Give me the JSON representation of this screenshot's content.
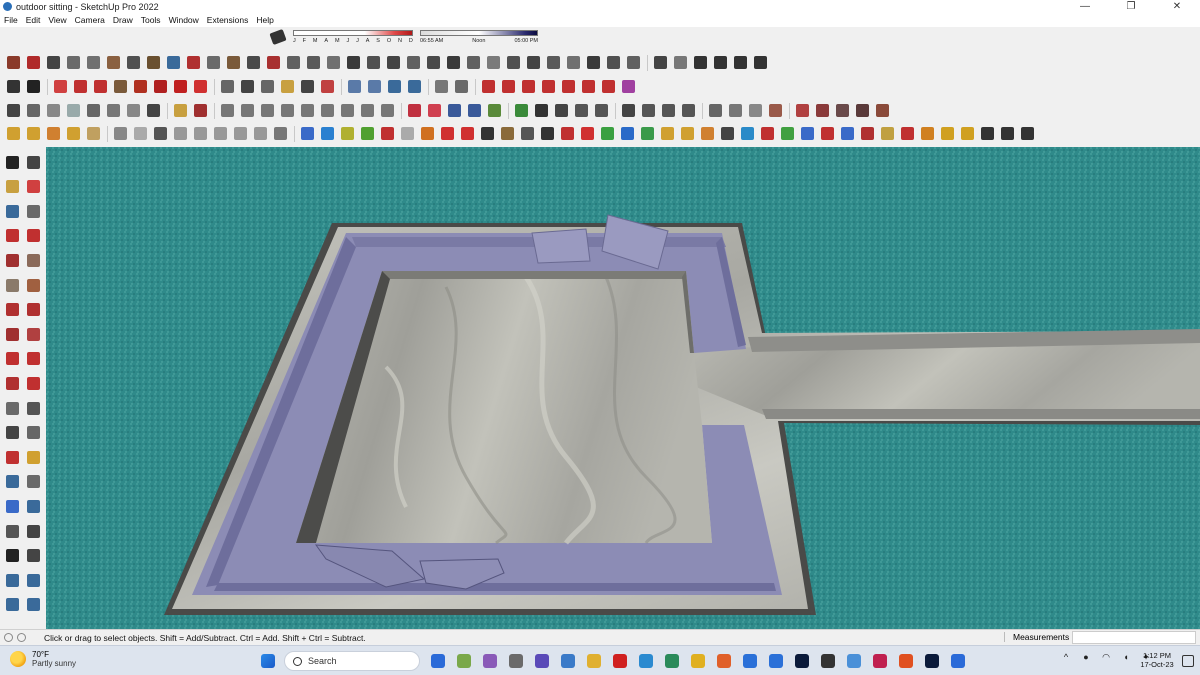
{
  "window": {
    "title": "outdoor sitting - SketchUp Pro 2022",
    "controls": [
      "—",
      "❐",
      "✕"
    ]
  },
  "menu": [
    "File",
    "Edit",
    "View",
    "Camera",
    "Draw",
    "Tools",
    "Window",
    "Extensions",
    "Help"
  ],
  "shadow_settings": {
    "months": [
      "J",
      "F",
      "M",
      "A",
      "M",
      "J",
      "J",
      "A",
      "S",
      "O",
      "N",
      "D"
    ],
    "time_start": "06:55 AM",
    "time_noon": "Noon",
    "time_end": "05:00 PM"
  },
  "toolbars": {
    "row1_colors": [
      "#8a3a2a",
      "#b02a2a",
      "#444",
      "#6a6a6a",
      "#707070",
      "#8a6040",
      "#505050",
      "#6a5030",
      "#3a6a9a",
      "#b03030",
      "#6a6a6a",
      "#7a5a3a",
      "#4a4a4a",
      "#a83030",
      "#606060",
      "#5a5a5a",
      "#707070",
      "#3a3a3a",
      "#505050",
      "#444",
      "#606060",
      "#4a4a4a",
      "#3a3a3a",
      "#606060",
      "#7a7a7a",
      "#505050",
      "#444",
      "#5a5a5a",
      "#707070",
      "#3a3a3a",
      "#505050",
      "#606060",
      "#444",
      "#777",
      "#333",
      "#333",
      "#333",
      "#333"
    ],
    "row2_colors": [
      "#333",
      "#222",
      "#d04040",
      "#c03030",
      "#c03030",
      "#7a5a3a",
      "#b03020",
      "#b02020",
      "#c02020",
      "#d03030",
      "#666",
      "#444",
      "#666",
      "#c8a040",
      "#444",
      "#c04040",
      "#5a7aa8",
      "#5a7aa8",
      "#3a6a9a",
      "#3a6a9a",
      "#777",
      "#6a6a6a",
      "#c03030",
      "#c03030",
      "#c03030",
      "#c03030",
      "#c03030",
      "#c03030",
      "#c03030",
      "#a040a0"
    ],
    "row3_colors": [
      "#444",
      "#666",
      "#888",
      "#9aa",
      "#666",
      "#777",
      "#888",
      "#444",
      "#c8a040",
      "#a03030",
      "#777",
      "#777",
      "#777",
      "#777",
      "#777",
      "#777",
      "#777",
      "#777",
      "#777",
      "#c03040",
      "#d04050",
      "#3a5a9a",
      "#3a5a9a",
      "#5a8a3a",
      "#3a8a3a",
      "#333",
      "#444",
      "#555",
      "#555",
      "#444",
      "#555",
      "#555",
      "#555",
      "#666",
      "#777",
      "#888",
      "#9a5a4a",
      "#b04040",
      "#8a3a3a",
      "#6a4a4a",
      "#5a3a3a",
      "#8a4a3a"
    ],
    "row4_colors": [
      "#d0a030",
      "#d0a030",
      "#d08030",
      "#d0a030",
      "#c0a060",
      "#888",
      "#aaa",
      "#555",
      "#999",
      "#999",
      "#999",
      "#999",
      "#999",
      "#777",
      "#3a6ac8",
      "#2a80d0",
      "#b0b030",
      "#50a030",
      "#c03030",
      "#aaa",
      "#d07020",
      "#d03030",
      "#d03030",
      "#333",
      "#8a6a3a",
      "#555",
      "#333",
      "#c03030",
      "#d03030",
      "#3aa040",
      "#2a6ac8",
      "#3a9a4a",
      "#d0a030",
      "#d0a030",
      "#d08030",
      "#444",
      "#2a8ac8",
      "#c03030",
      "#40a040",
      "#3a6ac8",
      "#c03030",
      "#3a6ac8",
      "#b03030",
      "#c0a040",
      "#c03030",
      "#d08020",
      "#d0a020",
      "#d0a020",
      "#333",
      "#333",
      "#333"
    ]
  },
  "left_toolbar_colors": [
    "#222",
    "#444",
    "#c8a040",
    "#d04040",
    "#3a6a9a",
    "#6a6a6a",
    "#c03030",
    "#c03030",
    "#a03030",
    "#8a6a5a",
    "#8a7a6a",
    "#a06040",
    "#b03030",
    "#b03030",
    "#a03030",
    "#b04040",
    "#c03030",
    "#c03030",
    "#b03030",
    "#c03030",
    "#6a6a6a",
    "#555",
    "#444",
    "#666",
    "#c03030",
    "#d0a030",
    "#3a6a9a",
    "#6a6a6a",
    "#3a6ac8",
    "#3a6a9a",
    "#555",
    "#444",
    "#222",
    "#444",
    "#3a6a9a",
    "#3a6a9a",
    "#3a6a9a",
    "#3a6a9a"
  ],
  "viewport": {
    "ground_color": "#2f8a8a",
    "seat_color": "#8c8cb5",
    "marble_color": "#b8b8b2"
  },
  "statusbar": {
    "hint": "Click or drag to select objects. Shift = Add/Subtract. Ctrl = Add. Shift + Ctrl = Subtract.",
    "measurements_label": "Measurements",
    "measurements_value": ""
  },
  "taskbar": {
    "weather_temp": "70°F",
    "weather_desc": "Partly sunny",
    "search_label": "Search",
    "time": "1:12 PM",
    "date": "17-Oct-23",
    "app_colors": [
      "#2a6ad8",
      "#7aa84a",
      "#8a5ab8",
      "#6a6a6a",
      "#5a4ab8",
      "#3a7ac8",
      "#e0b030",
      "#d02020",
      "#2a8ad0",
      "#2a8a5a",
      "#e0b020",
      "#e0602a",
      "#2a70d8",
      "#2a70d8",
      "#0a1a3a",
      "#333",
      "#4a90d8",
      "#c02050",
      "#e05020",
      "#0a1a3a",
      "#2a6ad8"
    ],
    "tray_icons": [
      "^",
      "●",
      "◠",
      "◖",
      "✦"
    ]
  }
}
